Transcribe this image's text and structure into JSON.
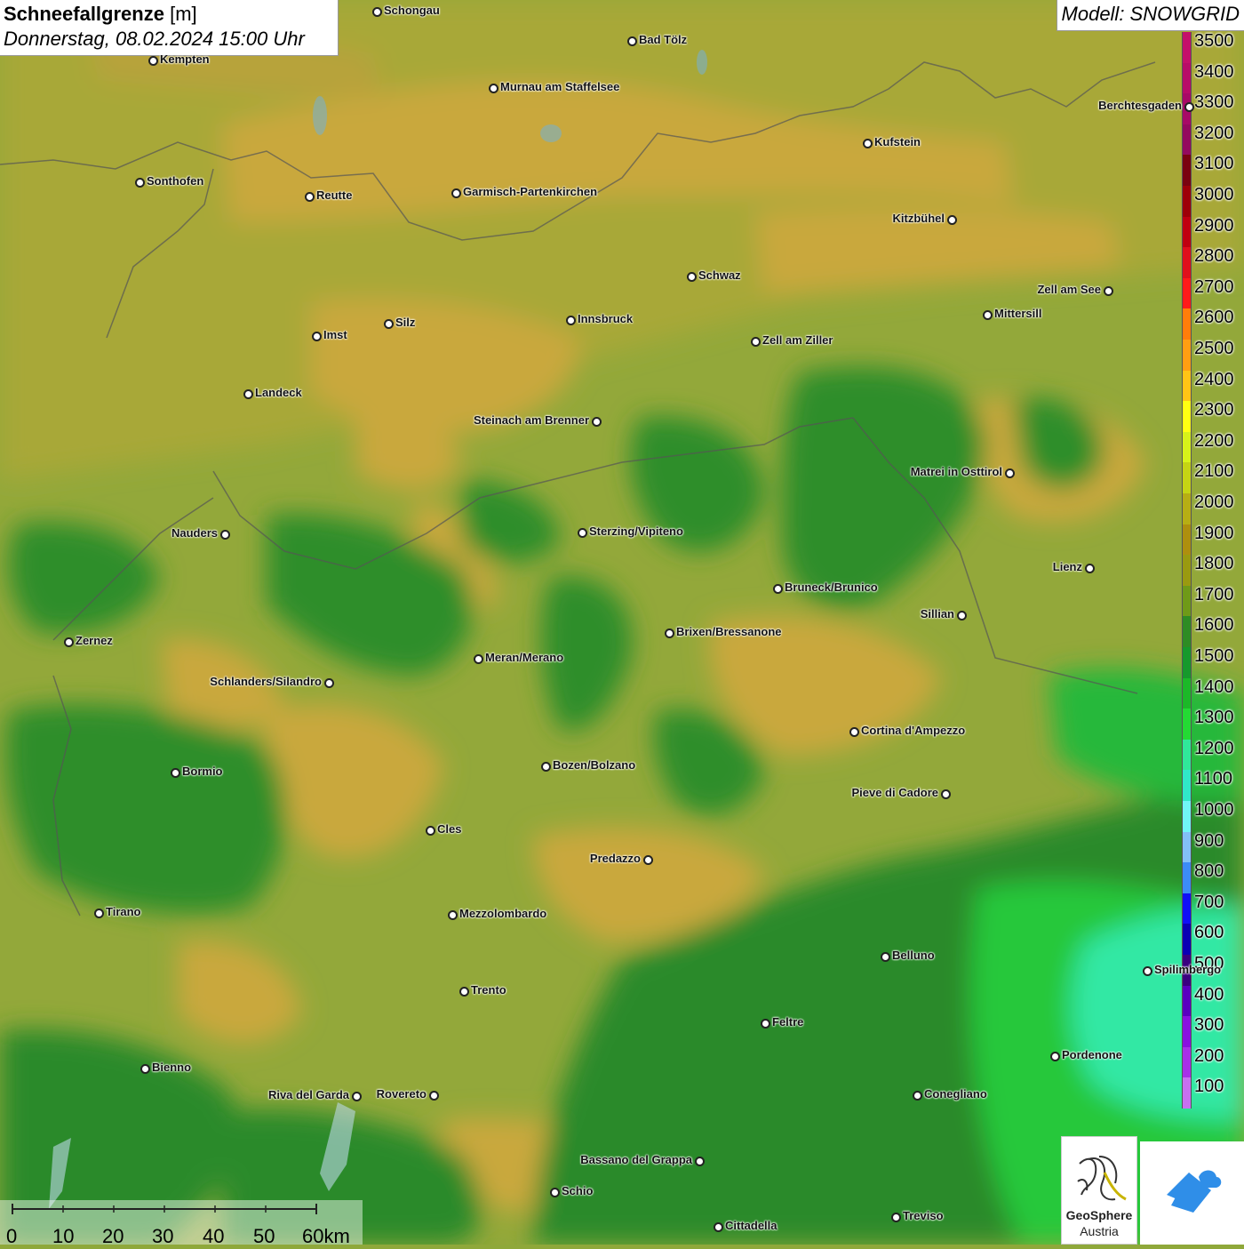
{
  "title": {
    "bold": "Schneefallgrenze",
    "unit": "[m]",
    "datetime": "Donnerstag, 08.02.2024 15:00 Uhr"
  },
  "model_label": "Modell: SNOWGRID",
  "legend": {
    "labels": [
      "3500",
      "3400",
      "3300",
      "3200",
      "3100",
      "3000",
      "2900",
      "2800",
      "2700",
      "2600",
      "2500",
      "2400",
      "2300",
      "2200",
      "2100",
      "2000",
      "1900",
      "1800",
      "1700",
      "1600",
      "1500",
      "1400",
      "1300",
      "1200",
      "1100",
      "1000",
      "900",
      "800",
      "700",
      "600",
      "500",
      "400",
      "300",
      "200",
      "100"
    ],
    "colors": [
      "#c4106a",
      "#b80c68",
      "#a80a66",
      "#940a5e",
      "#7a0210",
      "#9e0008",
      "#c00010",
      "#e0101c",
      "#ff1a1a",
      "#ff7d0a",
      "#ff9e12",
      "#ffc416",
      "#ffff12",
      "#d7f21a",
      "#c5d414",
      "#b7ae14",
      "#ae8f0e",
      "#9a9a10",
      "#6f9a18",
      "#2e8c24",
      "#16992c",
      "#1cb828",
      "#24da34",
      "#30e89a",
      "#30e8c8",
      "#70f6f6",
      "#82c0f6",
      "#3c8cf6",
      "#1010f6",
      "#0a00b4",
      "#3a0080",
      "#5a00c0",
      "#8a10e0",
      "#a830e8",
      "#c870f0"
    ]
  },
  "cities": [
    {
      "name": "Schongau"
    },
    {
      "name": "Bad Tölz"
    },
    {
      "name": "Kempten"
    },
    {
      "name": "Murnau am Staffelsee"
    },
    {
      "name": "Berchtesgaden"
    },
    {
      "name": "Kufstein"
    },
    {
      "name": "Sonthofen"
    },
    {
      "name": "Reutte"
    },
    {
      "name": "Garmisch-Partenkirchen"
    },
    {
      "name": "Kitzbühel"
    },
    {
      "name": "Schwaz"
    },
    {
      "name": "Zell am See"
    },
    {
      "name": "Mittersill"
    },
    {
      "name": "Innsbruck"
    },
    {
      "name": "Imst"
    },
    {
      "name": "Silz"
    },
    {
      "name": "Zell am Ziller"
    },
    {
      "name": "Landeck"
    },
    {
      "name": "Steinach am Brenner"
    },
    {
      "name": "Matrei in Osttirol"
    },
    {
      "name": "Nauders"
    },
    {
      "name": "Sterzing/Vipiteno"
    },
    {
      "name": "Lienz"
    },
    {
      "name": "Bruneck/Brunico"
    },
    {
      "name": "Sillian"
    },
    {
      "name": "Zernez"
    },
    {
      "name": "Brixen/Bressanone"
    },
    {
      "name": "Meran/Merano"
    },
    {
      "name": "Schlanders/Silandro"
    },
    {
      "name": "Cortina d'Ampezzo"
    },
    {
      "name": "Bozen/Bolzano"
    },
    {
      "name": "Bormio"
    },
    {
      "name": "Pieve di Cadore"
    },
    {
      "name": "Cles"
    },
    {
      "name": "Predazzo"
    },
    {
      "name": "Tirano"
    },
    {
      "name": "Mezzolombardo"
    },
    {
      "name": "Belluno"
    },
    {
      "name": "Spilimbergo"
    },
    {
      "name": "Trento"
    },
    {
      "name": "Feltre"
    },
    {
      "name": "Pordenone"
    },
    {
      "name": "Bienno"
    },
    {
      "name": "Riva del Garda"
    },
    {
      "name": "Rovereto"
    },
    {
      "name": "Conegliano"
    },
    {
      "name": "Bassano del Grappa"
    },
    {
      "name": "Schio"
    },
    {
      "name": "Treviso"
    },
    {
      "name": "Cittadella"
    }
  ],
  "scale": {
    "ticks": [
      "0",
      "10",
      "20",
      "30",
      "40",
      "50",
      "60km"
    ]
  },
  "logo": {
    "line1": "GeoSphere",
    "line2": "Austria"
  }
}
